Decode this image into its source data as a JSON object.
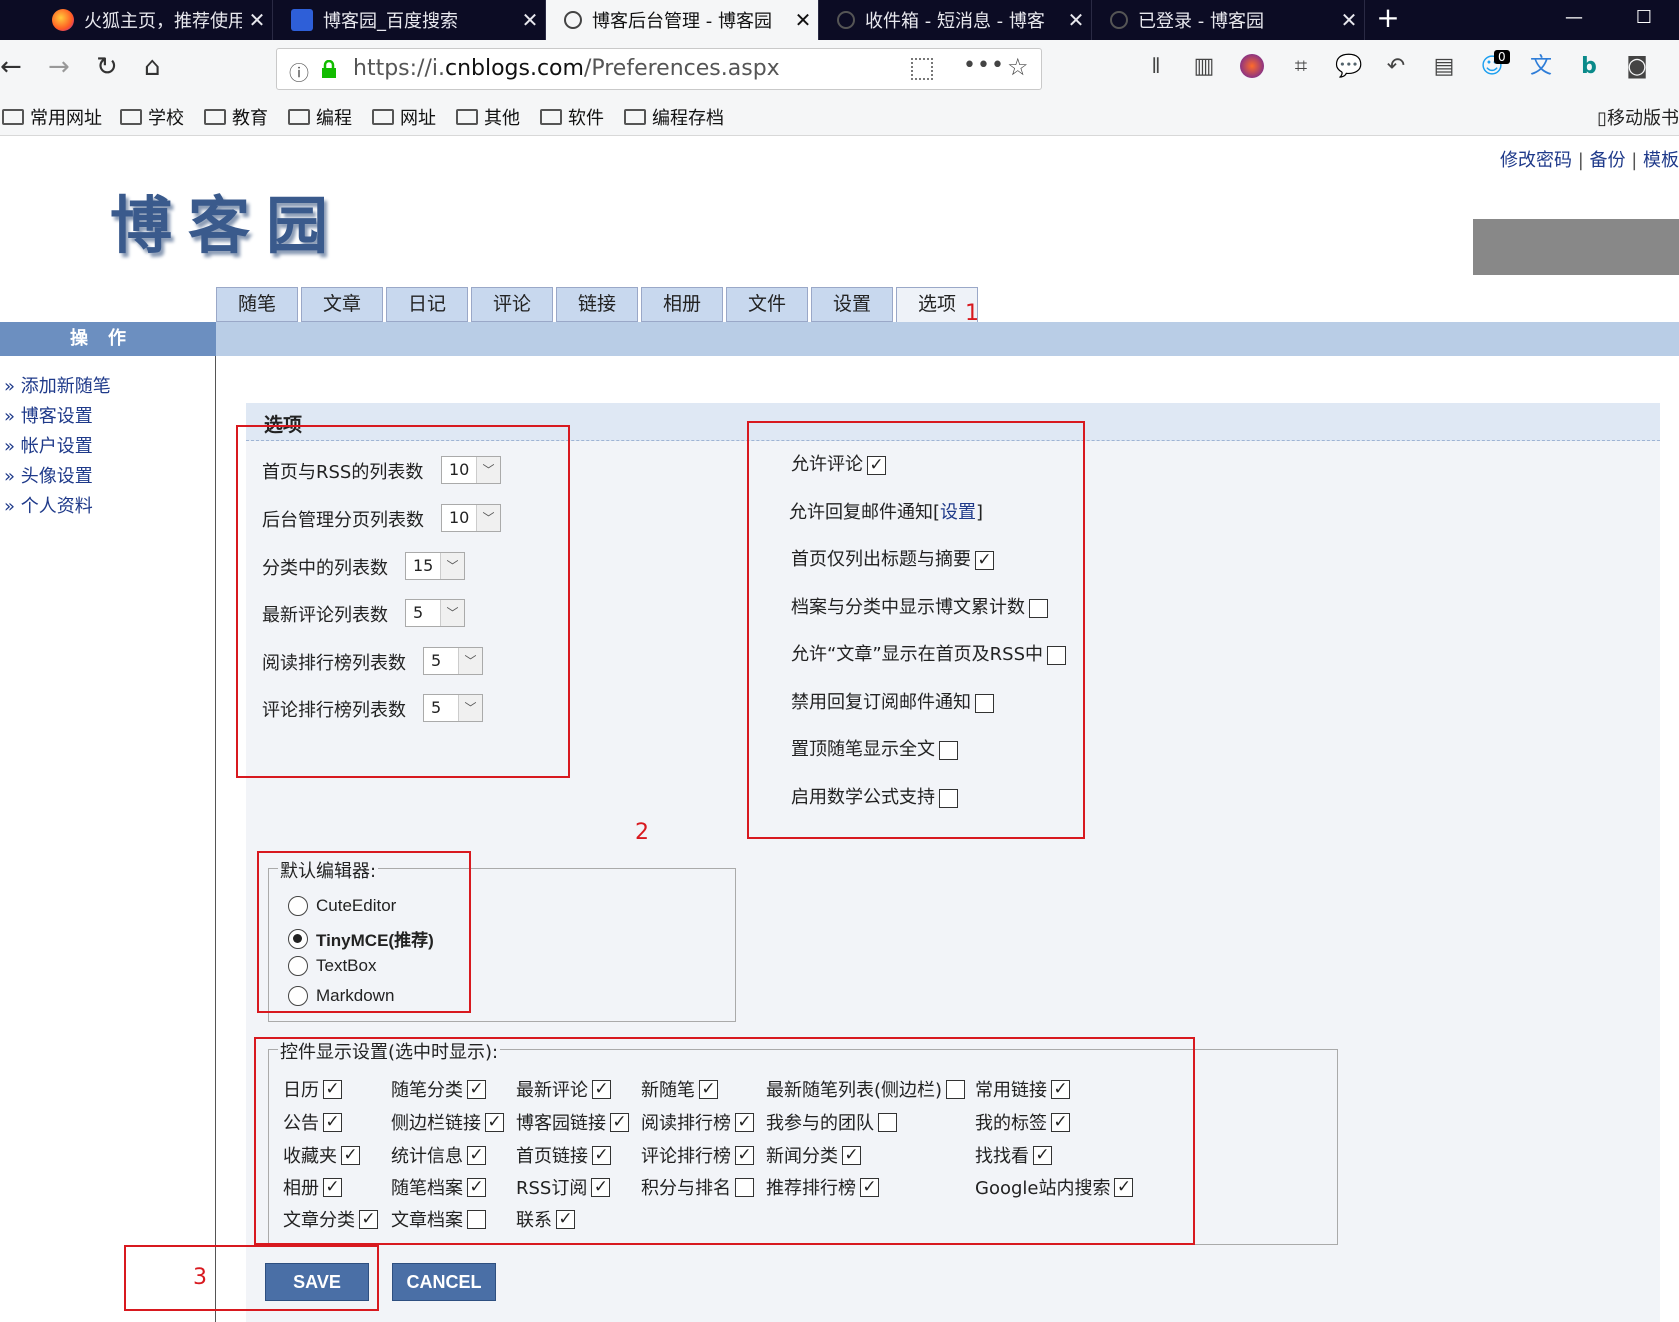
{
  "browser": {
    "tabs": [
      {
        "title": "火狐主页，推荐使用 Fi",
        "active": false
      },
      {
        "title": "博客园_百度搜索",
        "active": false
      },
      {
        "title": "博客后台管理 - 博客园",
        "active": true
      },
      {
        "title": "收件箱 - 短消息 - 博客",
        "active": false
      },
      {
        "title": "已登录 - 博客园",
        "active": false
      }
    ],
    "url_prefix": "https://i.",
    "url_host": "cnblogs.com",
    "url_path": "/Preferences.aspx",
    "notification_count": "0",
    "bookmarks": [
      "常用网址",
      "学校",
      "教育",
      "编程",
      "网址",
      "其他",
      "软件",
      "编程存档"
    ],
    "mobile_bookmark": "移动版书"
  },
  "header": {
    "links": [
      "修改密码",
      "备份",
      "模板"
    ],
    "logo": "博客园"
  },
  "nav_tabs": [
    "随笔",
    "文章",
    "日记",
    "评论",
    "链接",
    "相册",
    "文件",
    "设置",
    "选项"
  ],
  "sidebar": {
    "title": "操作",
    "items": [
      "» 添加新随笔",
      "» 博客设置",
      "» 帐户设置",
      "» 头像设置",
      "» 个人资料"
    ]
  },
  "options": {
    "title": "选项",
    "list_counts": [
      {
        "label": "首页与RSS的列表数",
        "value": "10"
      },
      {
        "label": "后台管理分页列表数",
        "value": "10"
      },
      {
        "label": "分类中的列表数",
        "value": "15"
      },
      {
        "label": "最新评论列表数",
        "value": "5"
      },
      {
        "label": "阅读排行榜列表数",
        "value": "5"
      },
      {
        "label": "评论排行榜列表数",
        "value": "5"
      }
    ],
    "toggles": [
      {
        "label": "允许评论",
        "checked": true
      },
      {
        "label": "首页仅列出标题与摘要",
        "checked": true
      },
      {
        "label": "档案与分类中显示博文累计数",
        "checked": false
      },
      {
        "label": "允许“文章”显示在首页及RSS中",
        "checked": false
      },
      {
        "label": "禁用回复订阅邮件通知",
        "checked": false
      },
      {
        "label": "置顶随笔显示全文",
        "checked": false
      },
      {
        "label": "启用数学公式支持",
        "checked": false
      }
    ],
    "reply_mail_label": "允许回复邮件通知[",
    "reply_mail_link": "设置",
    "reply_mail_end": "]"
  },
  "editor": {
    "legend": "默认编辑器:",
    "options": [
      {
        "label": "CuteEditor",
        "selected": false
      },
      {
        "label": "TinyMCE(推荐)",
        "selected": true
      },
      {
        "label": "TextBox",
        "selected": false
      },
      {
        "label": "Markdown",
        "selected": false
      }
    ]
  },
  "widgets": {
    "legend": "控件显示设置(选中时显示):",
    "items": [
      {
        "label": "日历",
        "checked": true
      },
      {
        "label": "随笔分类",
        "checked": true
      },
      {
        "label": "最新评论",
        "checked": true
      },
      {
        "label": "新随笔",
        "checked": true
      },
      {
        "label": "最新随笔列表(侧边栏)",
        "checked": false
      },
      {
        "label": "常用链接",
        "checked": true
      },
      {
        "label": "公告",
        "checked": true
      },
      {
        "label": "侧边栏链接",
        "checked": true
      },
      {
        "label": "博客园链接",
        "checked": true
      },
      {
        "label": "阅读排行榜",
        "checked": true
      },
      {
        "label": "我参与的团队",
        "checked": false
      },
      {
        "label": "我的标签",
        "checked": true
      },
      {
        "label": "收藏夹",
        "checked": true
      },
      {
        "label": "统计信息",
        "checked": true
      },
      {
        "label": "首页链接",
        "checked": true
      },
      {
        "label": "评论排行榜",
        "checked": true
      },
      {
        "label": "新闻分类",
        "checked": true
      },
      {
        "label": "找找看",
        "checked": true
      },
      {
        "label": "相册",
        "checked": true
      },
      {
        "label": "随笔档案",
        "checked": true
      },
      {
        "label": "RSS订阅",
        "checked": true
      },
      {
        "label": "积分与排名",
        "checked": false
      },
      {
        "label": "推荐排行榜",
        "checked": true
      },
      {
        "label": "Google站内搜索",
        "checked": true
      },
      {
        "label": "文章分类",
        "checked": true
      },
      {
        "label": "文章档案",
        "checked": false
      },
      {
        "label": "联系",
        "checked": true
      }
    ]
  },
  "buttons": {
    "save": "SAVE",
    "cancel": "CANCEL"
  },
  "annotations": {
    "n1": "1",
    "n2": "2",
    "n3": "3"
  },
  "colors": {
    "annotation_red": "#d8191f",
    "nav_blue": "#b9cde6",
    "button_blue": "#4a6fa6"
  }
}
